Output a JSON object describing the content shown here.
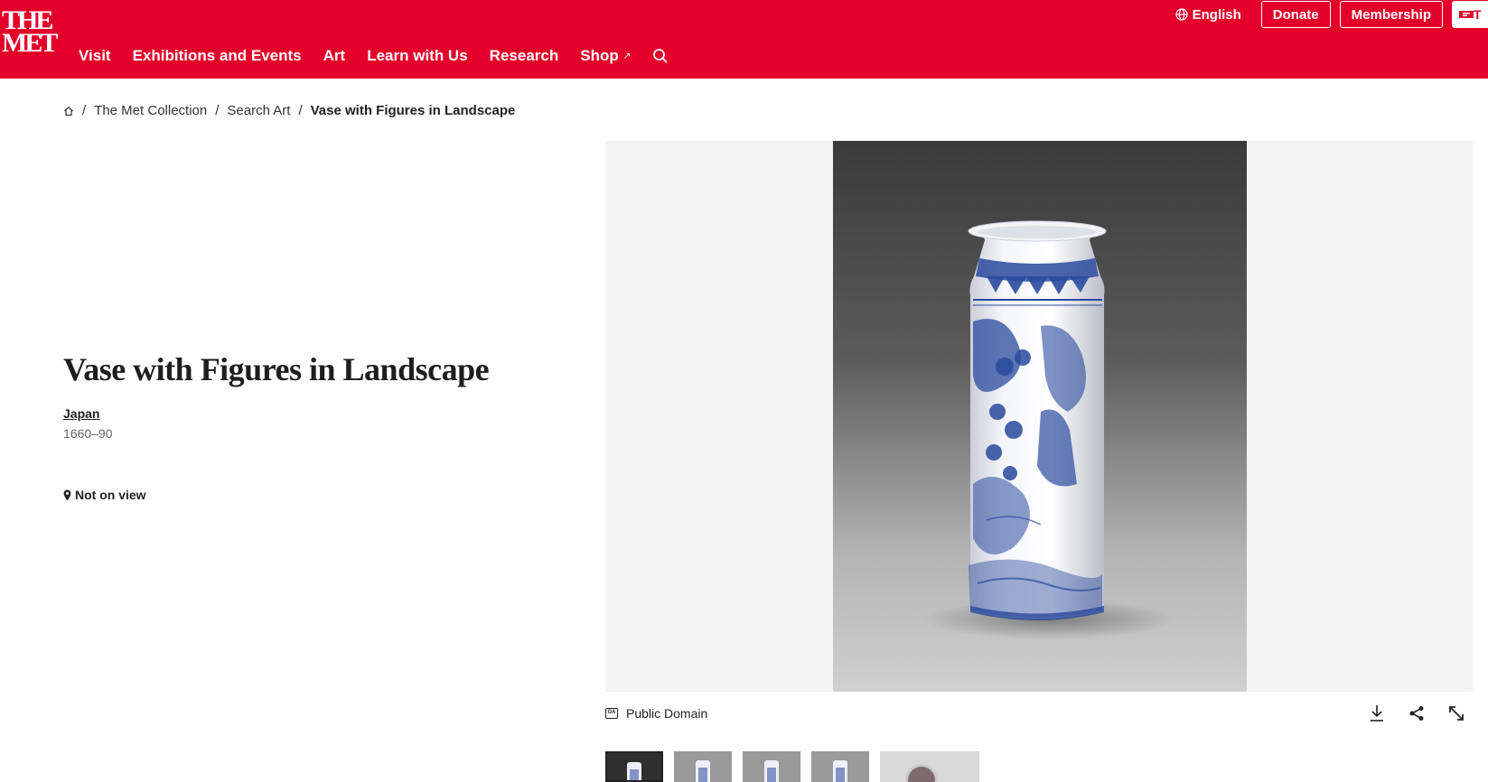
{
  "header": {
    "logo": {
      "line1": "THE",
      "line2": "MET"
    },
    "nav": [
      {
        "label": "Visit"
      },
      {
        "label": "Exhibitions and Events"
      },
      {
        "label": "Art"
      },
      {
        "label": "Learn with Us"
      },
      {
        "label": "Research"
      },
      {
        "label": "Shop",
        "external_mark": "↗"
      }
    ],
    "language": "English",
    "donate": "Donate",
    "membership": "Membership",
    "tickets_partial": "T"
  },
  "breadcrumb": {
    "items": [
      "The Met Collection",
      "Search Art"
    ],
    "current": "Vase with Figures in Landscape",
    "separator": "/"
  },
  "artwork": {
    "title": "Vase with Figures in Landscape",
    "culture": "Japan",
    "date": "1660–90",
    "on_view_status": "Not on view"
  },
  "image_panel": {
    "rights": "Public Domain",
    "rights_icon_text": "OA"
  },
  "colors": {
    "brand_red": "#e4002b",
    "panel_bg": "#f3f3f3",
    "cobalt": "#2a4a9e"
  }
}
